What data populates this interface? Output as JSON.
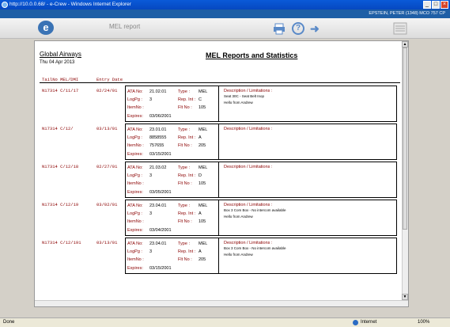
{
  "window": {
    "title": "http://10.0.0.68/ - e-Crew - Windows Internet Explorer",
    "min": "_",
    "max": "□",
    "close": "×"
  },
  "header": {
    "user": "EPSTEIN, PETER (1348) MCO 757 CP",
    "app_title": "MEL report",
    "logo_letter": "e"
  },
  "icons": [
    "printer-icon",
    "help-icon",
    "exit-icon",
    "document-stack-icon"
  ],
  "report": {
    "airline": "Global Airways",
    "date": "Thu  04 Apr 2013",
    "title": "MEL Reports and Statistics",
    "col_tail": "TailNo MEL/DMI",
    "col_entry": "Entry Date",
    "labels": {
      "ata": "ATA No:",
      "logpg": "LogPg :",
      "itemno": "ItemNo :",
      "expires": "Expires:",
      "type": "Type :",
      "repint": "Rep. Int :",
      "fltno": "Flt No :",
      "desc": "Description / Limitations :"
    },
    "records": [
      {
        "tail": "N17314 C/11/17",
        "entry": "02/24/01",
        "ata": "21.02.01",
        "logpg": "3",
        "itemno": "",
        "expires": "03/06/2001",
        "type": "MEL",
        "repint": "C",
        "fltno": "105",
        "desc": [
          "Seat 30C - Seat Belt Inop",
          "Hello from Andrew"
        ]
      },
      {
        "tail": "N17314 C/12/",
        "entry": "03/13/01",
        "ata": "23.01.01",
        "logpg": "8858555",
        "itemno": "757655",
        "expires": "03/15/2001",
        "type": "MEL",
        "repint": "A",
        "fltno": "205",
        "desc": [
          "",
          ""
        ]
      },
      {
        "tail": "N17314 C/12/18",
        "entry": "02/27/01",
        "ata": "21.03.02",
        "logpg": "3",
        "itemno": "",
        "expires": "03/05/2001",
        "type": "MEL",
        "repint": "D",
        "fltno": "105",
        "desc": [
          "",
          ""
        ]
      },
      {
        "tail": "N17314 C/12/19",
        "entry": "03/02/01",
        "ata": "23.04.01",
        "logpg": "3",
        "itemno": "",
        "expires": "03/04/2001",
        "type": "MEL",
        "repint": "A",
        "fltno": "105",
        "desc": [
          "Box 3 Com Box - No intercom available",
          "Hello from Andrew"
        ]
      },
      {
        "tail": "N17314 C/12/191",
        "entry": "03/13/01",
        "ata": "23.04.01",
        "logpg": "3",
        "itemno": "",
        "expires": "03/15/2001",
        "type": "MEL",
        "repint": "A",
        "fltno": "205",
        "desc": [
          "Box 3 Com Box - No intercom available",
          "Hello from Andrew"
        ]
      }
    ]
  },
  "status": {
    "left": "Done",
    "zone": "Internet",
    "zoom": "100%"
  }
}
